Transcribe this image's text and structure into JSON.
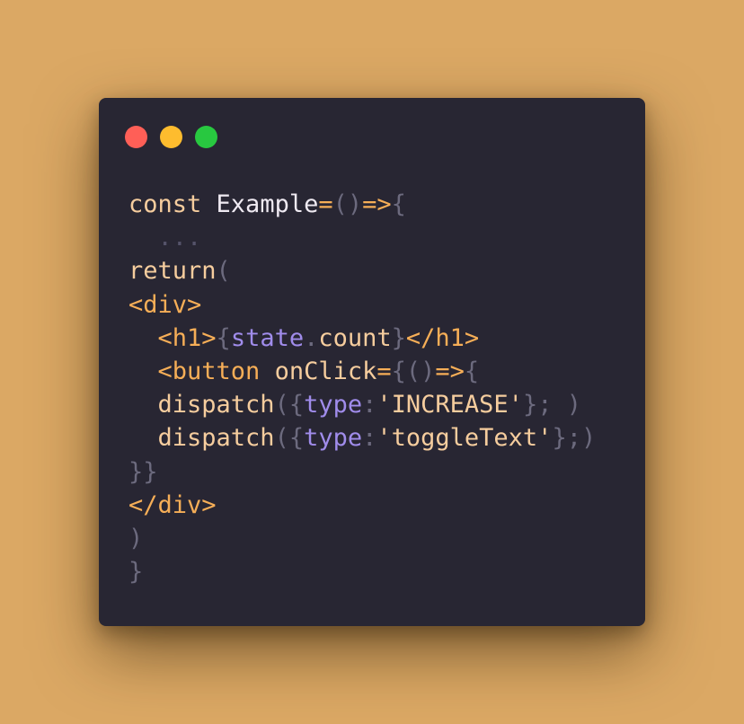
{
  "window": {
    "controls": [
      {
        "name": "close",
        "color": "#FF5F57"
      },
      {
        "name": "minimize",
        "color": "#FEBC2E"
      },
      {
        "name": "maximize",
        "color": "#28C840"
      }
    ]
  },
  "colors": {
    "keyword": "#F6CD9E",
    "identifier": "#EFEAF2",
    "punctuation": "#6C6A7E",
    "operator": "#F6AE57",
    "tag": "#F6AE57",
    "property": "#A08CEB",
    "string": "#F6CD9E",
    "comment": "#55536A"
  },
  "code_lines": [
    [
      {
        "text": "const ",
        "type": "keyword"
      },
      {
        "text": "Example",
        "type": "identifier"
      },
      {
        "text": "=",
        "type": "operator"
      },
      {
        "text": "()",
        "type": "punctuation"
      },
      {
        "text": "=>",
        "type": "operator"
      },
      {
        "text": "{",
        "type": "punctuation"
      }
    ],
    [
      {
        "text": "  ...",
        "type": "comment"
      }
    ],
    [
      {
        "text": "return",
        "type": "keyword"
      },
      {
        "text": "(",
        "type": "punctuation"
      }
    ],
    [
      {
        "text": "<div>",
        "type": "tag"
      }
    ],
    [
      {
        "text": "  <h1>",
        "type": "tag"
      },
      {
        "text": "{",
        "type": "punctuation"
      },
      {
        "text": "state",
        "type": "property"
      },
      {
        "text": ".",
        "type": "punctuation"
      },
      {
        "text": "count",
        "type": "keyword"
      },
      {
        "text": "}",
        "type": "punctuation"
      },
      {
        "text": "</h1>",
        "type": "tag"
      }
    ],
    [
      {
        "text": "  <button ",
        "type": "tag"
      },
      {
        "text": "onClick",
        "type": "keyword"
      },
      {
        "text": "=",
        "type": "operator"
      },
      {
        "text": "{()",
        "type": "punctuation"
      },
      {
        "text": "=>",
        "type": "operator"
      },
      {
        "text": "{",
        "type": "punctuation"
      }
    ],
    [
      {
        "text": "  dispatch",
        "type": "keyword"
      },
      {
        "text": "({",
        "type": "punctuation"
      },
      {
        "text": "type",
        "type": "property"
      },
      {
        "text": ":",
        "type": "punctuation"
      },
      {
        "text": "'INCREASE'",
        "type": "string"
      },
      {
        "text": "}; )",
        "type": "punctuation"
      }
    ],
    [
      {
        "text": "  dispatch",
        "type": "keyword"
      },
      {
        "text": "({",
        "type": "punctuation"
      },
      {
        "text": "type",
        "type": "property"
      },
      {
        "text": ":",
        "type": "punctuation"
      },
      {
        "text": "'toggleText'",
        "type": "string"
      },
      {
        "text": "};)",
        "type": "punctuation"
      }
    ],
    [
      {
        "text": "}}",
        "type": "punctuation"
      }
    ],
    [
      {
        "text": "</div>",
        "type": "tag"
      }
    ],
    [
      {
        "text": ")",
        "type": "punctuation"
      }
    ],
    [
      {
        "text": "}",
        "type": "punctuation"
      }
    ]
  ]
}
